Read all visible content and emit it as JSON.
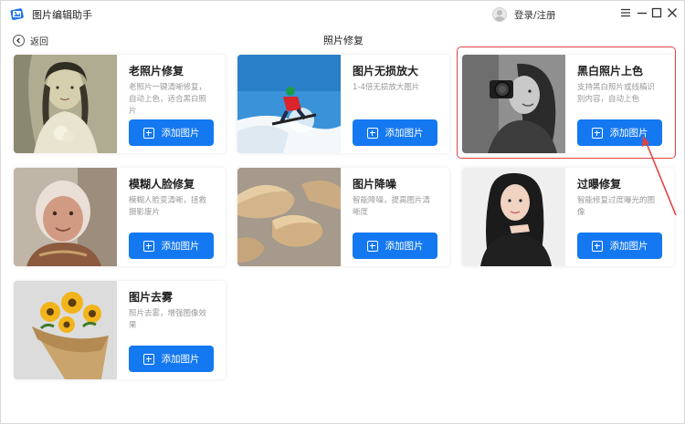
{
  "app": {
    "title": "图片编辑助手",
    "user_label": "登录/注册",
    "back_label": "返回",
    "page_title": "照片修复"
  },
  "cards": [
    {
      "title": "老照片修复",
      "desc": "老照片一键清晰修复，自动上色，适合黑白照片",
      "button": "添加图片",
      "image": "vintage-portrait-photo"
    },
    {
      "title": "图片无损放大",
      "desc": "1-4倍无损放大图片",
      "button": "添加图片",
      "image": "snowboarder-photo"
    },
    {
      "title": "黑白照片上色",
      "desc": "支持黑白照片或线稿识别内容，自动上色",
      "button": "添加图片",
      "image": "bw-camera-woman-photo"
    },
    {
      "title": "模糊人脸修复",
      "desc": "模糊人脸变清晰，拯救摄影废片",
      "button": "添加图片",
      "image": "elderly-woman-photo"
    },
    {
      "title": "图片降噪",
      "desc": "智能降噪，提高图片清晰度",
      "button": "添加图片",
      "image": "sand-dunes-photo"
    },
    {
      "title": "过曝修复",
      "desc": "智能修复过度曝光的图像",
      "button": "添加图片",
      "image": "woman-portrait-photo"
    },
    {
      "title": "图片去雾",
      "desc": "照片去雾，增强图像效果",
      "button": "添加图片",
      "image": "sunflower-bouquet-photo"
    }
  ],
  "colors": {
    "accent": "#1478f0",
    "highlight": "#e04343"
  },
  "icons": [
    "app-logo-icon",
    "user-avatar-icon",
    "menu-icon",
    "minimize-icon",
    "maximize-icon",
    "close-icon",
    "back-arrow-icon",
    "plus-icon"
  ]
}
